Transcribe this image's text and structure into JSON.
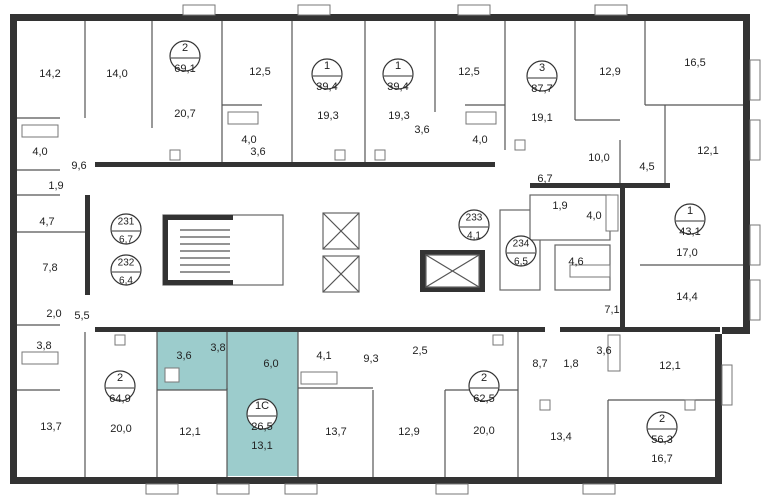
{
  "colors": {
    "highlight": "#9ccccc",
    "wall": "#333333",
    "line": "#666666"
  },
  "apartments": [
    {
      "rooms": "2",
      "total": "69,1"
    },
    {
      "rooms": "1",
      "total": "39,4"
    },
    {
      "rooms": "1",
      "total": "39,4"
    },
    {
      "rooms": "3",
      "total": "87,7"
    },
    {
      "rooms": "231",
      "total": "6,7"
    },
    {
      "rooms": "232",
      "total": "6,4"
    },
    {
      "rooms": "233",
      "total": "4,1"
    },
    {
      "rooms": "234",
      "total": "6,5"
    },
    {
      "rooms": "1",
      "total": "43,1"
    },
    {
      "rooms": "2",
      "total": "64,9"
    },
    {
      "rooms": "1С",
      "total": "26,5"
    },
    {
      "rooms": "2",
      "total": "62,5"
    },
    {
      "rooms": "2",
      "total": "56,3"
    }
  ],
  "room_areas": [
    "14,2",
    "14,0",
    "20,7",
    "12,5",
    "19,3",
    "19,3",
    "12,5",
    "19,1",
    "12,9",
    "16,5",
    "4,0",
    "3,6",
    "3,6",
    "4,0",
    "10,0",
    "12,1",
    "4,5",
    "4,0",
    "9,6",
    "1,9",
    "6,7",
    "4,7",
    "7,8",
    "1,9",
    "4,0",
    "4,6",
    "17,0",
    "14,4",
    "7,1",
    "2,0",
    "5,5",
    "3,8",
    "3,6",
    "3,8",
    "6,0",
    "4,1",
    "9,3",
    "2,5",
    "8,7",
    "1,8",
    "3,6",
    "12,1",
    "13,7",
    "20,0",
    "12,1",
    "13,1",
    "13,7",
    "12,9",
    "20,0",
    "13,4",
    "16,7"
  ]
}
